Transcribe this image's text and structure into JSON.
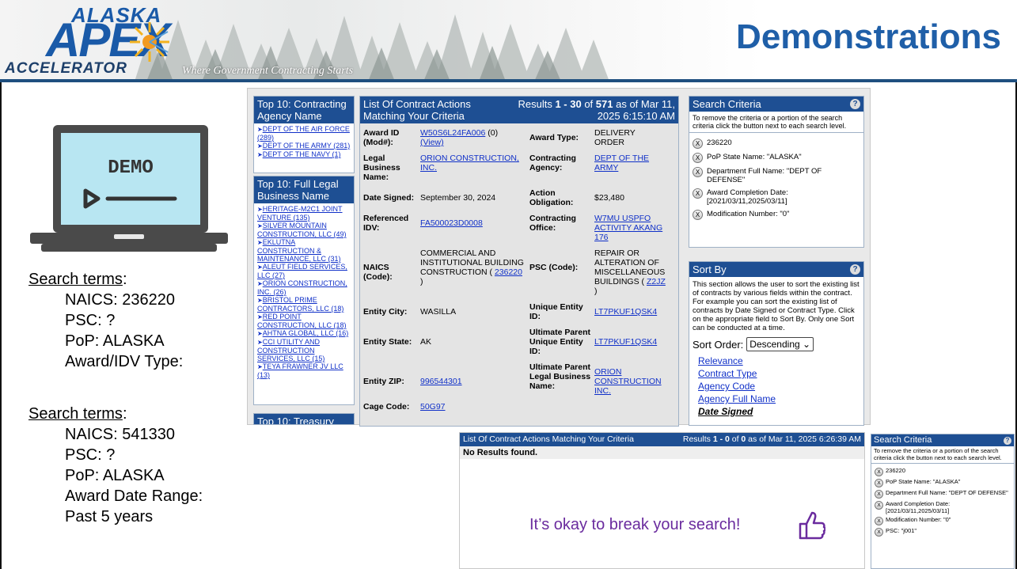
{
  "header": {
    "logo_top": "ALASKA",
    "logo_main": "APEX",
    "logo_bottom": "ACCELERATOR",
    "tagline": "Where Government Contracting Starts",
    "title": "Demonstrations"
  },
  "demo_graphic": {
    "label": "DEMO",
    "icon": "laptop-play-icon"
  },
  "search_terms_1": {
    "heading": "Search terms",
    "colon": ":",
    "items": [
      "NAICS: 236220",
      "PSC: ?",
      "PoP: ALASKA",
      "Award/IDV Type:"
    ]
  },
  "search_terms_2": {
    "heading": "Search terms",
    "colon": ":",
    "items": [
      "NAICS: 541330",
      "PSC: ?",
      "PoP: ALASKA",
      "Award Date Range:",
      "Past 5 years"
    ]
  },
  "top10_agency": {
    "title": "Top 10: Contracting Agency Name",
    "items": [
      "DEPT OF THE AIR FORCE (289)",
      "DEPT OF THE ARMY (281)",
      "DEPT OF THE NAVY (1)"
    ]
  },
  "top10_business": {
    "title": "Top 10: Full Legal Business Name",
    "items": [
      "HERITAGE-M2C1 JOINT VENTURE (135)",
      "SILVER MOUNTAIN CONSTRUCTION, LLC (49)",
      "EKLUTNA CONSTRUCTION & MAINTENANCE, LLC (31)",
      "ALEUT FIELD SERVICES, LLC (27)",
      "ORION CONSTRUCTION, INC. (26)",
      "BRISTOL PRIME CONTRACTORS, LLC (18)",
      "RED POINT CONSTRUCTION, LLC (18)",
      "AHTNA GLOBAL, LLC (16)",
      "CCI UTILITY AND CONSTRUCTION SERVICES, LLC (15)",
      "TEYA FRAWNER JV LLC (13)"
    ]
  },
  "top10_treasury": {
    "title": "Top 10: Treasury"
  },
  "results": {
    "header_left": "List Of Contract Actions Matching Your Criteria",
    "header_right_prefix": "Results ",
    "range": "1 - 30",
    "of_word": " of ",
    "total": "571",
    "as_of": " as of Mar 11, 2025 6:15:10 AM",
    "award_id_label": "Award ID (Mod#):",
    "award_id": "W50S6L24FA006",
    "mod": "(0)",
    "view": "(View)",
    "award_type_label": "Award Type:",
    "award_type": "DELIVERY ORDER",
    "legal_name_label": "Legal Business Name:",
    "legal_name": "ORION CONSTRUCTION, INC.",
    "contracting_agency_label": "Contracting Agency:",
    "contracting_agency": "DEPT OF THE ARMY",
    "date_signed_label": "Date Signed:",
    "date_signed": "September 30, 2024",
    "action_obligation_label": "Action Obligation:",
    "action_obligation": "$23,480",
    "ref_idv_label": "Referenced IDV:",
    "ref_idv": "FA500023D0008",
    "contracting_office_label": "Contracting Office:",
    "contracting_office": "W7MU USPFO ACTIVITY AKANG 176",
    "naics_label": "NAICS (Code):",
    "naics_text": "COMMERCIAL AND INSTITUTIONAL BUILDING CONSTRUCTION ( ",
    "naics_code": "236220",
    "naics_close": " )",
    "psc_label": "PSC (Code):",
    "psc_text": "REPAIR OR ALTERATION OF MISCELLANEOUS BUILDINGS ( ",
    "psc_code": "Z2JZ",
    "psc_close": " )",
    "entity_city_label": "Entity City:",
    "entity_city": "WASILLA",
    "uei_label": "Unique Entity ID:",
    "uei": "LT7PKUF1QSK4",
    "entity_state_label": "Entity State:",
    "entity_state": "AK",
    "parent_uei_label": "Ultimate Parent Unique Entity ID:",
    "parent_uei": "LT7PKUF1QSK4",
    "entity_zip_label": "Entity ZIP:",
    "entity_zip": "996544301",
    "parent_name_label": "Ultimate Parent Legal Business Name:",
    "parent_name": "ORION CONSTRUCTION INC.",
    "cage_label": "Cage Code:",
    "cage": "50G97"
  },
  "search_criteria": {
    "title": "Search Criteria",
    "help": "?",
    "description": "To remove the criteria or a portion of the search criteria click the button next to each search level.",
    "remove_glyph": "X",
    "items": [
      "236220",
      "PoP State Name: \"ALASKA\"",
      "Department Full Name: \"DEPT OF DEFENSE\"",
      "Award Completion Date: [2021/03/11,2025/03/11]",
      "Modification Number: \"0\""
    ]
  },
  "sort_by": {
    "title": "Sort By",
    "help": "?",
    "description": "This section allows the user to sort the existing list of contracts by various fields within the contract. For example you can sort the existing list of contracts by Date Signed or Contract Type. Click on the appropriate field to Sort By. Only one Sort can be conducted at a time.",
    "order_label": "Sort Order:",
    "order_value": "Descending",
    "links": [
      "Relevance",
      "Contract Type",
      "Agency Code",
      "Agency Full Name",
      "Date Signed"
    ]
  },
  "results2": {
    "header_left": "List Of Contract Actions Matching Your Criteria",
    "header_right_prefix": "Results ",
    "range": "1 - 0",
    "of_word": " of ",
    "total": "0",
    "as_of": " as of Mar 11, 2025 6:26:39 AM",
    "no_results": "No Results found.",
    "message": "It’s okay to break your search!"
  },
  "search_criteria_2": {
    "title": "Search Criteria",
    "help": "?",
    "description": "To remove the criteria or a portion of the search criteria click the button next to each search level.",
    "remove_glyph": "X",
    "items": [
      "236220",
      "PoP State Name: \"ALASKA\"",
      "Department Full Name: \"DEPT OF DEFENSE\"",
      "Award Completion Date: [2021/03/11,2025/03/11]",
      "Modification Number: \"0\"",
      "PSC: \"j001\""
    ]
  },
  "colors": {
    "brand_blue": "#1f5fa8",
    "panel_header": "#1e4f93",
    "link_blue": "#1030c8",
    "message_purple": "#6a2b9e"
  }
}
